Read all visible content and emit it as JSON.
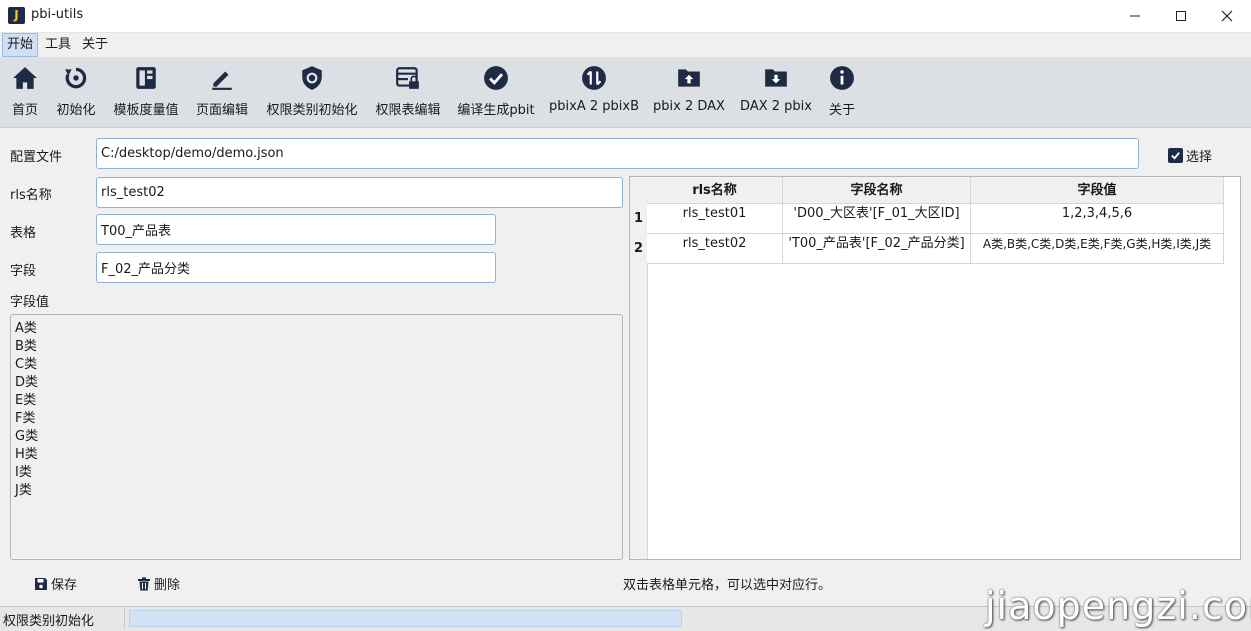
{
  "window": {
    "title": "pbi-utils",
    "icon_letter": "J"
  },
  "menu": [
    "开始",
    "工具",
    "关于"
  ],
  "toolbar": [
    {
      "label": "首页",
      "icon": "home-icon"
    },
    {
      "label": "初始化",
      "icon": "reset-icon"
    },
    {
      "label": "模板度量值",
      "icon": "template-icon"
    },
    {
      "label": "页面编辑",
      "icon": "edit-icon"
    },
    {
      "label": "权限类别初始化",
      "icon": "shield-gear-icon"
    },
    {
      "label": "权限表编辑",
      "icon": "lock-table-icon"
    },
    {
      "label": "编译生成pbit",
      "icon": "check-circle-icon"
    },
    {
      "label": "pbixA 2 pbixB",
      "icon": "swap-icon"
    },
    {
      "label": "pbix 2 DAX",
      "icon": "folder-upload-icon"
    },
    {
      "label": "DAX 2 pbix",
      "icon": "folder-download-icon"
    },
    {
      "label": "关于",
      "icon": "info-icon"
    }
  ],
  "form": {
    "config_label": "配置文件",
    "config_value": "C:/desktop/demo/demo.json",
    "choose_label": "选择",
    "rls_label": "rls名称",
    "rls_value": "rls_test02",
    "table_label": "表格",
    "table_value": "T00_产品表",
    "field_label": "字段",
    "field_value": "F_02_产品分类",
    "values_label": "字段值",
    "values": [
      "A类",
      "B类",
      "C类",
      "D类",
      "E类",
      "F类",
      "G类",
      "H类",
      "I类",
      "J类"
    ]
  },
  "table": {
    "headers": [
      "rls名称",
      "字段名称",
      "字段值"
    ],
    "rows": [
      {
        "num": "1",
        "cells": [
          "rls_test01",
          "'D00_大区表'[F_01_大区ID]",
          "1,2,3,4,5,6"
        ]
      },
      {
        "num": "2",
        "cells": [
          "rls_test02",
          "'T00_产品表'[F_02_产品分类]",
          "A类,B类,C类,D类,E类,F类,G类,H类,I类,J类"
        ]
      }
    ]
  },
  "actions": {
    "save": "保存",
    "delete": "删除"
  },
  "hint": "双击表格单元格，可以选中对应行。",
  "status": {
    "text": "权限类别初始化"
  },
  "watermark": "jiaopengzi.com",
  "colors": {
    "icon": "#1f2a44",
    "toolbar_bg": "#dcdfe4",
    "input_border": "#8eb2d8"
  }
}
